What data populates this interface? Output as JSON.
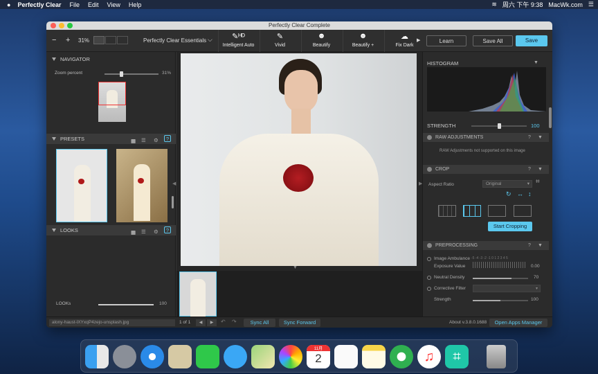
{
  "menubar": {
    "apple": "",
    "app": "Perfectly Clear",
    "items": [
      "File",
      "Edit",
      "View",
      "Help"
    ],
    "datetime": "周六 下午 9:38",
    "site": "MacWk.com"
  },
  "window": {
    "title": "Perfectly Clear Complete"
  },
  "toolbar": {
    "zoom": "31%",
    "preset_menu": "Perfectly Clear Essentials",
    "tools": [
      {
        "label": "Intelligent Auto",
        "icon": "brush-hd-icon"
      },
      {
        "label": "Vivid",
        "icon": "brush-icon"
      },
      {
        "label": "Beautify",
        "icon": "face-icon"
      },
      {
        "label": "Beautify +",
        "icon": "face-plus-icon"
      },
      {
        "label": "Fix Dark",
        "icon": "cloud-icon"
      }
    ],
    "learn": "Learn",
    "save_all": "Save All",
    "save": "Save"
  },
  "navigator": {
    "title": "NAVIGATOR",
    "zoom_label": "Zoom percent",
    "zoom_value": "31%",
    "zoom_fraction": 0.31
  },
  "presets": {
    "title": "PRESETS"
  },
  "looks": {
    "title": "LOOKS",
    "slider_label": "LOOKs",
    "slider_value": "100",
    "slider_fraction": 1.0
  },
  "histogram": {
    "title": "HISTOGRAM",
    "strength_label": "STRENGTH",
    "strength_value": "100",
    "strength_fraction": 0.5
  },
  "raw": {
    "title": "RAW ADJUSTMENTS",
    "message": "RAW Adjustments not supported on this image"
  },
  "crop": {
    "title": "CROP",
    "aspect_label": "Aspect Ratio",
    "aspect_value": "Original",
    "start": "Start Cropping"
  },
  "preprocessing": {
    "title": "PREPROCESSING",
    "ambulance_label": "Image Ambulance",
    "exposure_label": "Exposure Value",
    "exposure_value": "0.00",
    "scale_text": "-5 -4 -3 -2 -1 0 1 2 3 4 5",
    "neutral_label": "Neutral Density",
    "neutral_value": "70",
    "neutral_fraction": 0.7,
    "corrective_label": "Corrective Filter",
    "strength_label": "Strength",
    "strength_value": "100",
    "strength_fraction": 0.5
  },
  "bottombar": {
    "filename": "alony-haust-lXYxqP4zejo-unsplash.jpg",
    "page": "1 of 1",
    "sync_all": "Sync All",
    "sync_forward": "Sync Forward",
    "version": "About v.3.8.0.1688",
    "open_apps": "Open Apps Manager"
  },
  "colors": {
    "accent": "#5bc8ee",
    "titlebar": "#dcdcdc",
    "panel": "#2b2b2b"
  },
  "dock": [
    "finder-icon",
    "launchpad-icon",
    "safari-icon",
    "mail-icon",
    "facetime-icon",
    "messages-icon",
    "maps-icon",
    "photos-icon",
    "calendar-icon",
    "reminders-icon",
    "notes-icon",
    "app-icon",
    "music-icon",
    "perfectly-clear-icon",
    "trash-icon"
  ],
  "calendar": {
    "month": "11月",
    "day": "2"
  }
}
